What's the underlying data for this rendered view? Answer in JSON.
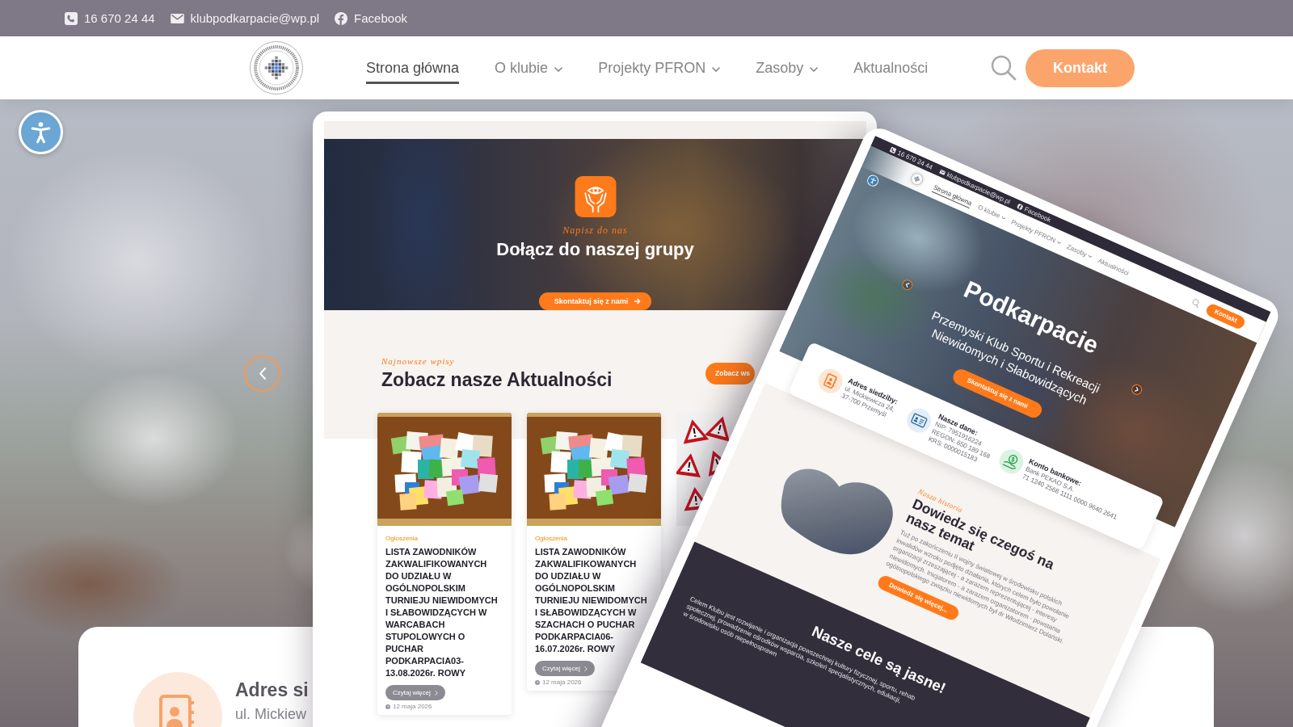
{
  "top_bar": {
    "items": [
      {
        "kind": "phone",
        "text": "16 670 24 44"
      },
      {
        "kind": "email",
        "text": "klubpodkarpacie@wp.pl"
      },
      {
        "kind": "facebook",
        "text": "Facebook"
      }
    ]
  },
  "nav": {
    "menu": [
      {
        "label": "Strona główna",
        "selected": true,
        "dropdown": false
      },
      {
        "label": "O klubie",
        "selected": false,
        "dropdown": true
      },
      {
        "label": "Projekty PFRON",
        "selected": false,
        "dropdown": true
      },
      {
        "label": "Zasoby",
        "selected": false,
        "dropdown": true
      },
      {
        "label": "Aktualności",
        "selected": false,
        "dropdown": false
      }
    ],
    "button": "Kontakt"
  },
  "info_card": {
    "title": "Adres si",
    "address": "ul. Mickiew"
  },
  "laptop_screen": {
    "banner": {
      "eyebrow": "Napisz do nas",
      "title": "Dołącz do naszej grupy",
      "button": "Skontaktuj się z nami"
    },
    "news": {
      "eyebrow": "Najnowsze wpisy",
      "title": "Zobacz nasze Aktualności",
      "button": "Zobacz ws",
      "posts": [
        {
          "kind": "notes",
          "category": "Ogłoszenia",
          "title": "LISTA ZAWODNIKÓW ZAKWALIFIKOWANYCH DO UDZIAŁU W OGÓLNOPOLSKIM TURNIEJU NIEWIDOMYCH I SŁABOWIDZĄCYCH W WARCABACH STUPOLOWYCH O PUCHAR PODKARPACIA03-\n13.08.2026r. ROWY",
          "button": "Czytaj więcej",
          "date": "12 maja 2026"
        },
        {
          "kind": "notes",
          "category": "Ogłoszenia",
          "title": "LISTA ZAWODNIKÓW ZAKWALIFIKOWANYCH DO UDZIAŁU W OGÓLNOPOLSKIM TURNIEJU NIEWIDOMYCH I SŁABOWIDZĄCYCH W SZACHACH O PUCHAR PODKARPACIA06-\n16.07.2026r. ROWY",
          "button": "Czytaj więcej",
          "date": "12 maja 2026"
        },
        {
          "kind": "signs"
        }
      ]
    }
  },
  "tablet_screen": {
    "top_bar": [
      {
        "kind": "phone",
        "text": "16 670 24 44"
      },
      {
        "kind": "email",
        "text": "klubpodkarpacie@wp.pl"
      },
      {
        "kind": "facebook",
        "text": "Facebook"
      }
    ],
    "menu": [
      {
        "label": "Strona główna",
        "selected": true,
        "dropdown": false
      },
      {
        "label": "O klubie",
        "selected": false,
        "dropdown": true
      },
      {
        "label": "Projekty PFRON",
        "selected": false,
        "dropdown": true
      },
      {
        "label": "Zasoby",
        "selected": false,
        "dropdown": true
      },
      {
        "label": "Aktualności",
        "selected": false,
        "dropdown": false
      }
    ],
    "button": "Kontakt",
    "hero": {
      "title": "Podkarpacie",
      "subtitle": "Przemyski Klub Sportu i Rekreacji Niewidomych i Słabowidzących",
      "button": "Skontaktuj się z nami"
    },
    "contacts": [
      {
        "kind": "address",
        "title": "Adres siedziby:",
        "lines": [
          "ul. Mickiewicza 24,",
          "37-700 Przemyśl"
        ]
      },
      {
        "kind": "company",
        "title": "Nasze dane:",
        "lines": [
          "NIP: 7951916224",
          "REGON: 650 189 168",
          "KRS: 0000015183"
        ]
      },
      {
        "kind": "bank",
        "title": "Konto bankowe:",
        "lines": [
          "Bank PEKAO S.A.",
          "71 1240 2568 1111 0000 9640 2641"
        ]
      }
    ],
    "history": {
      "eyebrow": "Nasza historia",
      "title": "Dowiedz się czegoś na nasz temat",
      "text": "Tuż po zakończeniu II wojny światowej w środowisku polskich inwalidów wzroku podjęto działania, których celem było powołanie organizacji zrzeszającej - a zarazem reprezentującej - interesy niewidomych. Inicjatorem - a zarazem organizatorem - powstania ogólnopolskiego związku niewidomych był dr Włodzimierz Dolański.",
      "button": "Dowiedz się więcej..."
    },
    "goals": {
      "title": "Nasze cele są jasne!",
      "text_lines": [
        "Celem Klubu jest rozwijanie i organizacja powszechnej kultury fizycznej, sportu, rehab",
        "społecznej, prowadzenie ośrodków wsparcia, szkoleń specjalistycznych, edukacji,",
        "w środowisku osób niepełnosprawn"
      ]
    }
  }
}
